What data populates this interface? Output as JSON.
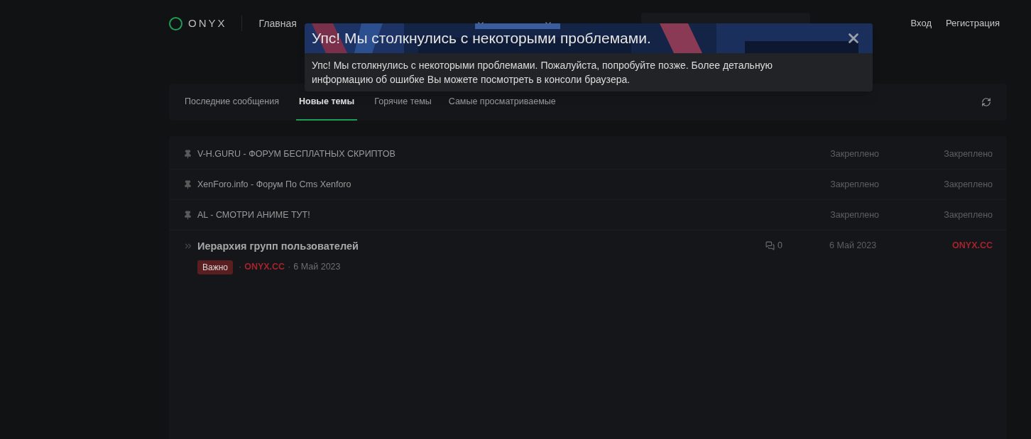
{
  "header": {
    "logo": "ONYX",
    "nav": [
      {
        "kind": "link",
        "label": "Главная"
      },
      {
        "kind": "caret"
      },
      {
        "kind": "caret"
      }
    ],
    "auth": [
      "Вход",
      "Регистрация"
    ]
  },
  "modal": {
    "title": "Упс! Мы столкнулись с некоторыми проблемами.",
    "message": "Упс! Мы столкнулись с некоторыми проблемами. Пожалуйста, попробуйте позже. Более детальную информацию об ошибке Вы можете посмотреть в консоли браузера."
  },
  "tabs": [
    {
      "label": "Последние сообщения",
      "selected": false
    },
    {
      "label": "Новые темы",
      "selected": true
    },
    {
      "label": "Горячие темы",
      "selected": false
    },
    {
      "label": "Самые просматриваемые",
      "selected": false
    }
  ],
  "threads": [
    {
      "kind": "pinned",
      "title": "V-H.GURU - ФОРУМ БЕСПЛАТНЫХ СКРИПТОВ",
      "date": "Закреплено",
      "last": "Закреплено"
    },
    {
      "kind": "pinned",
      "title": "XenForo.info - Форум По Cms Xenforo",
      "date": "Закреплено",
      "last": "Закреплено"
    },
    {
      "kind": "pinned",
      "title": "AL - СМОТРИ АНИМЕ ТУТ!",
      "date": "Закреплено",
      "last": "Закреплено"
    },
    {
      "kind": "normal",
      "title": "Иерархия групп пользователей",
      "tag": "Важно",
      "sep": "·",
      "author": "ONYX.CC",
      "posted": "6 Май 2023",
      "replies": "0",
      "date": "6 Май 2023",
      "last": "ONYX.CC"
    }
  ]
}
